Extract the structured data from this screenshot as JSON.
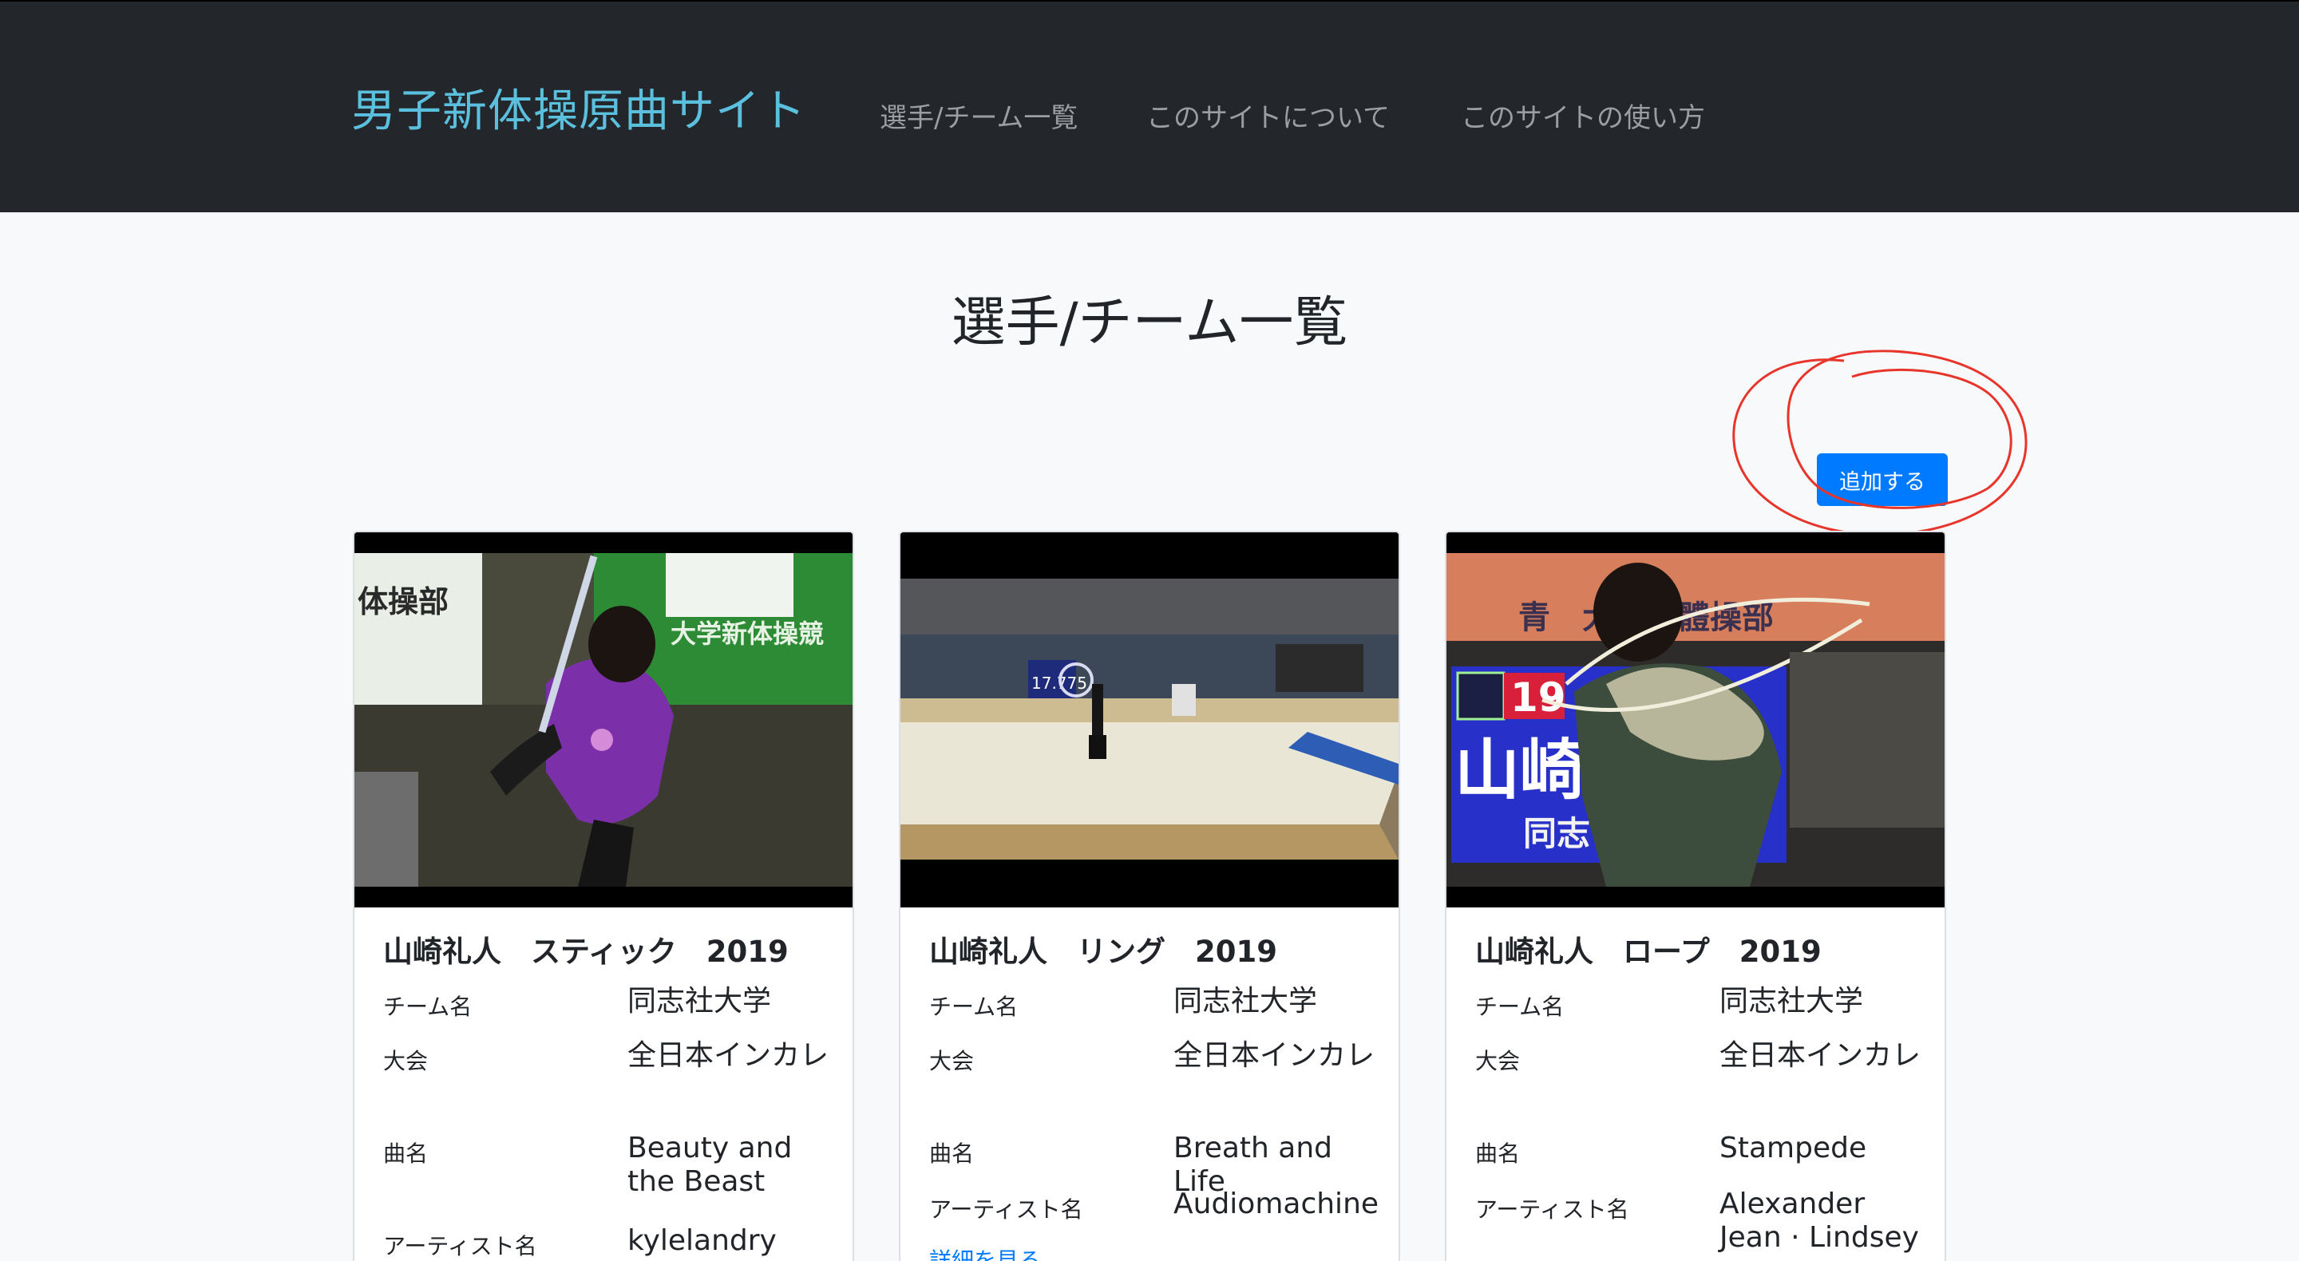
{
  "nav": {
    "brand": "男子新体操原曲サイト",
    "links": [
      "選手/チーム一覧",
      "このサイトについて",
      "このサイトの使い方"
    ]
  },
  "page": {
    "title": "選手/チーム一覧",
    "add_button": "追加する",
    "more_link": "詳細を見る"
  },
  "cards": [
    {
      "title": "山崎礼人　スティック　2019",
      "team_label": "チーム名",
      "team": "同志社大学",
      "event_label": "大会",
      "event": "全日本インカレ",
      "song_label": "曲名",
      "song": "Beauty and the Beast",
      "artist_label": "アーティスト名",
      "artist": "kylelandry"
    },
    {
      "title": "山崎礼人　リング　2019",
      "team_label": "チーム名",
      "team": "同志社大学",
      "event_label": "大会",
      "event": "全日本インカレ",
      "song_label": "曲名",
      "song": "Breath and Life",
      "artist_label": "アーティスト名",
      "artist": "Audiomachine"
    },
    {
      "title": "山崎礼人　ロープ　2019",
      "team_label": "チーム名",
      "team": "同志社大学",
      "event_label": "大会",
      "event": "全日本インカレ",
      "song_label": "曲名",
      "song": "Stampede",
      "artist_label": "アーティスト名",
      "artist": "Alexander Jean · Lindsey"
    }
  ],
  "thumb_text": {
    "stick_banner": "体操部",
    "stick_banner2": "大学新体操競",
    "ring_score": "17.775",
    "rope_number": "19",
    "rope_name": "山崎　人",
    "rope_school": "同志",
    "rope_banner": "青　大學新體操部"
  },
  "colors": {
    "navbar": "#23272b",
    "brand": "#5bc0de",
    "button": "#007bff",
    "annotation": "#e8352b"
  }
}
